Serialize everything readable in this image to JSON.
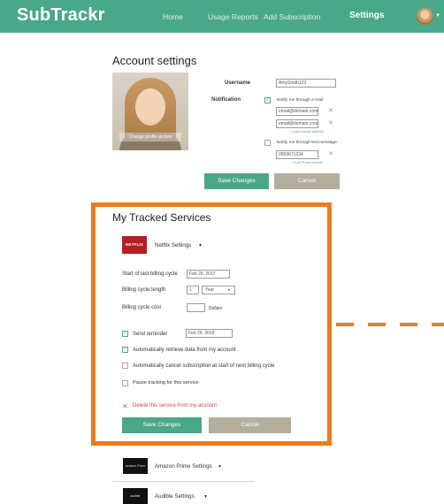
{
  "app": {
    "brand": "SubTrackr"
  },
  "nav": {
    "items": [
      {
        "label": "Home",
        "active": false
      },
      {
        "label": "Usage Reports",
        "active": false
      },
      {
        "label": "Add Subscription",
        "active": false
      },
      {
        "label": "Settings",
        "active": true
      }
    ]
  },
  "account": {
    "title": "Account settings",
    "photo_overlay": "Change profile picture",
    "username_label": "Username",
    "username_value": "AmySmith123",
    "notification_label": "Notification",
    "notify_email_label": "Notify me through e-mail:",
    "emails": [
      "email@domain.com",
      "email@domain.com"
    ],
    "add_email": "+ Add a email address",
    "notify_text_label": "Notify me through text message:",
    "phone": "2869671234",
    "add_phone": "+ Add Phone number",
    "save_label": "Save Changes",
    "cancel_label": "Cancel"
  },
  "tracked": {
    "title": "My Tracked Services",
    "netflix_logo": "NETFLIX",
    "netflix_settings": "Netflix Settings",
    "start_label": "Start of last billing cycle",
    "start_value": "Feb 26, 2017",
    "length_label": "Billing cycle length",
    "length_value": "1",
    "length_unit": "Year",
    "cost_label": "Billing cycle cost",
    "cost_value": "",
    "cost_unit": "Dollars",
    "reminder_label": "Send reminder",
    "reminder_value": "Feb 26, 2018",
    "auto_retrieve": "Automatically retrieve data from my account",
    "auto_cancel": "Automatically cancel subscription at start of next billing cycle",
    "pause": "Pause tracking for this service",
    "delete": "Delete this service from my account",
    "save_label": "Save Changes",
    "cancel_label": "Cancel"
  },
  "other_services": [
    {
      "logo": "amazon Prime",
      "label": "Amazon Prime Settings"
    },
    {
      "logo": "audible",
      "label": "Audible Settings"
    }
  ],
  "colors": {
    "brand_green": "#4aa88a",
    "highlight_orange": "#ee7a1d",
    "netflix_red": "#b81d24"
  }
}
